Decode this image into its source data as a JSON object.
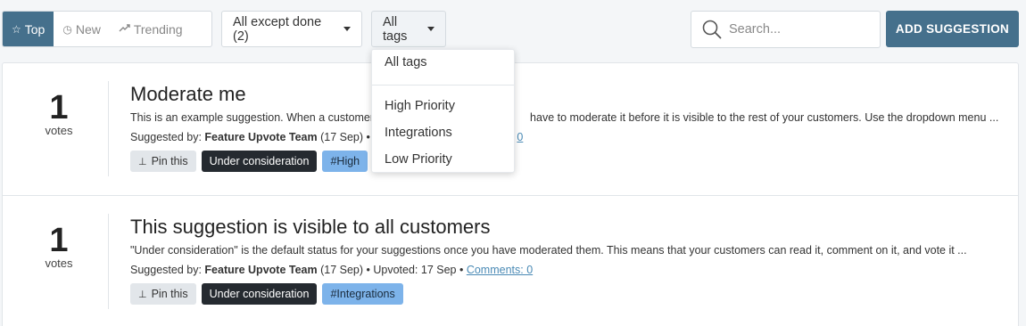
{
  "sort": {
    "top": {
      "label": "Top",
      "icon": "star-outline-icon"
    },
    "new": {
      "label": "New",
      "icon": "clock-icon"
    },
    "trending": {
      "label": "Trending",
      "icon": "trending-up-icon"
    }
  },
  "filters": {
    "status_label": "All except done (2)",
    "tags_label": "All tags"
  },
  "search": {
    "placeholder": "Search..."
  },
  "add_button": "ADD SUGGESTION",
  "tags_menu": {
    "items": [
      "All tags",
      "High Priority",
      "Integrations",
      "Low Priority"
    ]
  },
  "suggestions": [
    {
      "votes": "1",
      "votes_label": "votes",
      "title": "Moderate me",
      "desc_left": "This is an example suggestion. When a customer",
      "desc_right": "have to moderate it before it is visible to the rest of your customers. Use the dropdown menu ...",
      "meta_prefix": "Suggested by:",
      "author": "Feature Upvote Team",
      "meta_date": "(17 Sep) • U",
      "comments_tail": "0",
      "pin": "Pin this",
      "status": "Under consideration",
      "tag": "#High"
    },
    {
      "votes": "1",
      "votes_label": "votes",
      "title": "This suggestion is visible to all customers",
      "desc": "\"Under consideration\" is the default status for your suggestions once you have moderated them. This means that your customers can read it, comment on it, and vote it ...",
      "meta_prefix": "Suggested by:",
      "author": "Feature Upvote Team",
      "meta_date": "(17 Sep) • Upvoted: 17 Sep •",
      "comments": "Comments: 0",
      "pin": "Pin this",
      "status": "Under consideration",
      "tag": "#Integrations"
    }
  ],
  "colors": {
    "accent": "#45708c",
    "tag": "#7db3ea",
    "status_chip": "#252a30"
  }
}
